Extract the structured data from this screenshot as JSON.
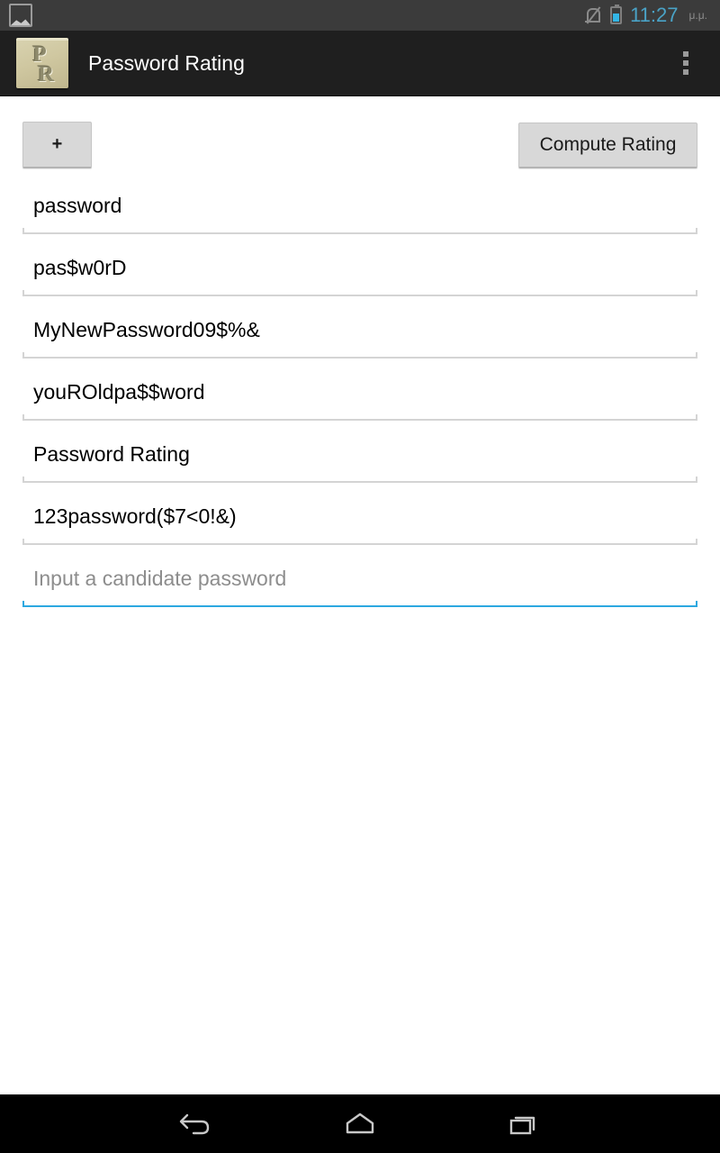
{
  "status_bar": {
    "notification_icon": "screenshot-icon",
    "mute_icon": "notifications-off-icon",
    "battery_icon": "battery-icon",
    "time": "11:27",
    "ampm": "μ.μ.",
    "time_color": "#4aa3c7"
  },
  "action_bar": {
    "app_icon": "app-logo-icon",
    "app_icon_letter_top": "P",
    "app_icon_letter_bottom": "R",
    "title": "Password Rating",
    "overflow_icon": "overflow-menu-icon",
    "background": "#1f1f1f"
  },
  "toolbar": {
    "add_label": "+",
    "compute_label": "Compute Rating"
  },
  "form": {
    "accent_color": "#2ca8e0",
    "fields": [
      {
        "value": "password",
        "placeholder": "",
        "focused": false
      },
      {
        "value": "pas$w0rD",
        "placeholder": "",
        "focused": false
      },
      {
        "value": "MyNewPassword09$%&",
        "placeholder": "",
        "focused": false
      },
      {
        "value": "youROldpa$$word",
        "placeholder": "",
        "focused": false
      },
      {
        "value": "Password Rating",
        "placeholder": "",
        "focused": false
      },
      {
        "value": "123password($7<0!&)",
        "placeholder": "",
        "focused": false
      },
      {
        "value": "",
        "placeholder": "Input a candidate password",
        "focused": true
      }
    ]
  },
  "nav_bar": {
    "back_icon": "back-icon",
    "home_icon": "home-icon",
    "recents_icon": "recents-icon"
  }
}
